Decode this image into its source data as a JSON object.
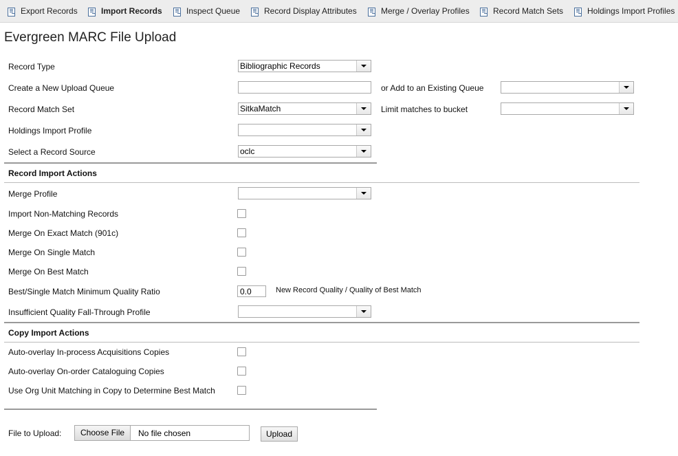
{
  "toolbar": {
    "items": [
      {
        "label": "Export Records",
        "icon": "document-icon"
      },
      {
        "label": "Import Records",
        "icon": "document-icon"
      },
      {
        "label": "Inspect Queue",
        "icon": "document-icon"
      },
      {
        "label": "Record Display Attributes",
        "icon": "document-icon"
      },
      {
        "label": "Merge / Overlay Profiles",
        "icon": "document-icon"
      },
      {
        "label": "Record Match Sets",
        "icon": "document-icon"
      },
      {
        "label": "Holdings Import Profiles",
        "icon": "document-icon"
      }
    ],
    "active": "Import Records"
  },
  "page_title": "Evergreen MARC File Upload",
  "form": {
    "record_type": {
      "label": "Record Type",
      "value": "Bibliographic Records"
    },
    "new_queue": {
      "label": "Create a New Upload Queue",
      "value": ""
    },
    "existing_queue": {
      "label": "or Add to an Existing Queue",
      "value": ""
    },
    "match_set": {
      "label": "Record Match Set",
      "value": "SitkaMatch"
    },
    "bucket": {
      "label": "Limit matches to bucket",
      "value": ""
    },
    "holdings_profile": {
      "label": "Holdings Import Profile",
      "value": ""
    },
    "record_source": {
      "label": "Select a Record Source",
      "value": "oclc"
    }
  },
  "record_import": {
    "heading": "Record Import Actions",
    "merge_profile": {
      "label": "Merge Profile",
      "value": ""
    },
    "import_non_matching": {
      "label": "Import Non-Matching Records",
      "checked": false
    },
    "merge_exact": {
      "label": "Merge On Exact Match (901c)",
      "checked": false
    },
    "merge_single": {
      "label": "Merge On Single Match",
      "checked": false
    },
    "merge_best": {
      "label": "Merge On Best Match",
      "checked": false
    },
    "quality_ratio": {
      "label": "Best/Single Match Minimum Quality Ratio",
      "value": "0.0",
      "hint": "New Record Quality / Quality of Best Match"
    },
    "fallthrough": {
      "label": "Insufficient Quality Fall-Through Profile",
      "value": ""
    }
  },
  "copy_import": {
    "heading": "Copy Import Actions",
    "auto_acq": {
      "label": "Auto-overlay In-process Acquisitions Copies",
      "checked": false
    },
    "auto_onorder": {
      "label": "Auto-overlay On-order Cataloguing Copies",
      "checked": false
    },
    "org_unit": {
      "label": "Use Org Unit Matching in Copy to Determine Best Match",
      "checked": false
    }
  },
  "upload": {
    "label": "File to Upload:",
    "choose": "Choose File",
    "status": "No file chosen",
    "button": "Upload"
  }
}
